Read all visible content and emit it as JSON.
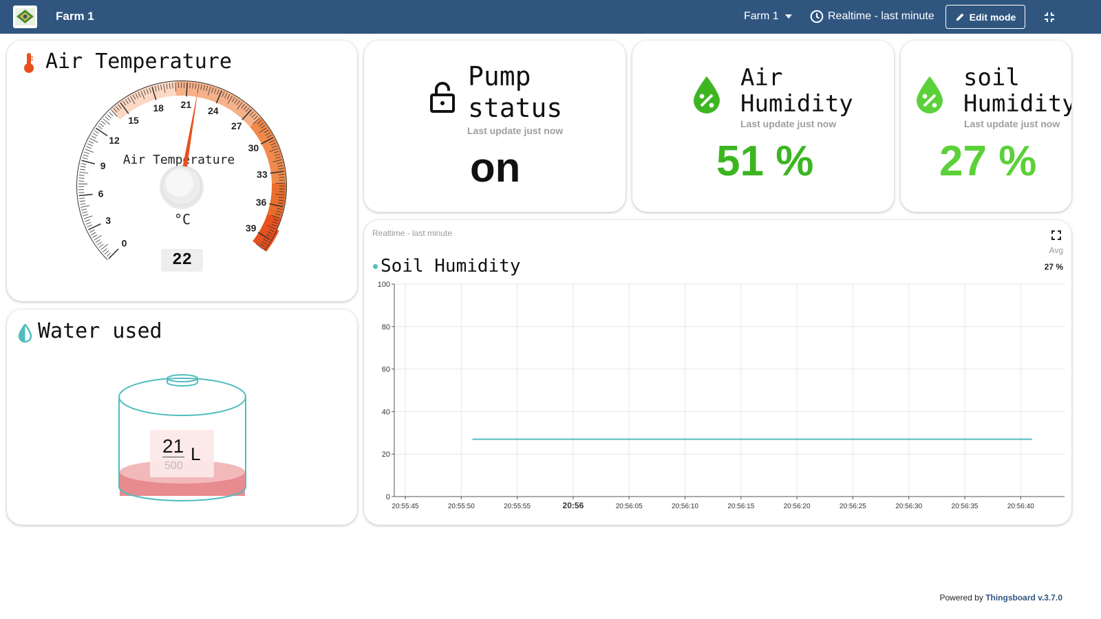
{
  "header": {
    "dashboard_title": "Farm 1",
    "state_selector": "Farm 1",
    "time_window": "Realtime - last minute",
    "edit_mode_label": "Edit mode"
  },
  "air_temperature": {
    "title": "Air Temperature",
    "gauge_label": "Air Temperature",
    "unit": "°C",
    "value": 22,
    "min": 0,
    "max": 40,
    "ticks": [
      "0",
      "3",
      "6",
      "9",
      "12",
      "15",
      "18",
      "21",
      "24",
      "27",
      "30",
      "33",
      "36",
      "39"
    ]
  },
  "pump": {
    "title_line1": "Pump",
    "title_line2": "status",
    "last_update": "Last update just now",
    "value": "on"
  },
  "air_humidity": {
    "title_line1": "Air",
    "title_line2": "Humidity",
    "last_update": "Last update just now",
    "value": "51 %",
    "color": "#3cb521"
  },
  "soil_humidity": {
    "title_line1": "soil",
    "title_line2": "Humidity",
    "last_update": "Last update just now",
    "value": "27 %",
    "color": "#5ad138"
  },
  "water": {
    "title": "Water used",
    "value": "21",
    "max": "500",
    "unit": "L",
    "fill_fraction": 0.042
  },
  "chart": {
    "window_label": "Realtime - last minute",
    "avg_label": "Avg",
    "avg_value": "27 %"
  },
  "chart_data": {
    "type": "line",
    "title": "Soil Humidity",
    "series": [
      {
        "name": "Soil Humidity",
        "color": "#4fbdbd",
        "x": [
          "20:55:51",
          "20:56:41"
        ],
        "values": [
          27,
          27
        ]
      }
    ],
    "yticks": [
      "0",
      "20",
      "40",
      "60",
      "80",
      "100"
    ],
    "ylim": [
      0,
      100
    ],
    "xticks": [
      "20:55:45",
      "20:55:50",
      "20:55:55",
      "20:56",
      "20:56:05",
      "20:56:10",
      "20:56:15",
      "20:56:20",
      "20:56:25",
      "20:56:30",
      "20:56:35",
      "20:56:40"
    ],
    "grid": true
  },
  "footer": {
    "prefix": "Powered by",
    "link": "Thingsboard v.3.7.0"
  }
}
